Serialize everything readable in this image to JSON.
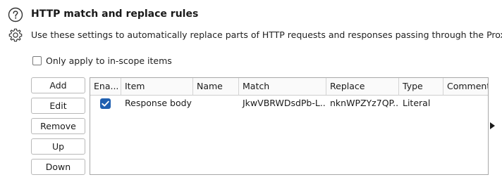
{
  "header": {
    "title": "HTTP match and replace rules",
    "description": "Use these settings to automatically replace parts of HTTP requests and responses passing through the Proxy.",
    "help_icon": "help-circle-icon",
    "settings_icon": "gear-icon"
  },
  "scope": {
    "label": "Only apply to in-scope items",
    "checked": false
  },
  "buttons": {
    "add": "Add",
    "edit": "Edit",
    "remove": "Remove",
    "up": "Up",
    "down": "Down"
  },
  "table": {
    "columns": [
      "Ena...",
      "Item",
      "Name",
      "Match",
      "Replace",
      "Type",
      "Comment"
    ],
    "rows": [
      {
        "enabled": true,
        "item": "Response body",
        "name": "",
        "match": "JkwVBRWDsdPb-L...",
        "replace": "nknWPZYz7QP...",
        "type": "Literal",
        "comment": ""
      }
    ]
  },
  "colors": {
    "checkbox_checked": "#1f5fb0",
    "border": "#a8a8a8"
  }
}
